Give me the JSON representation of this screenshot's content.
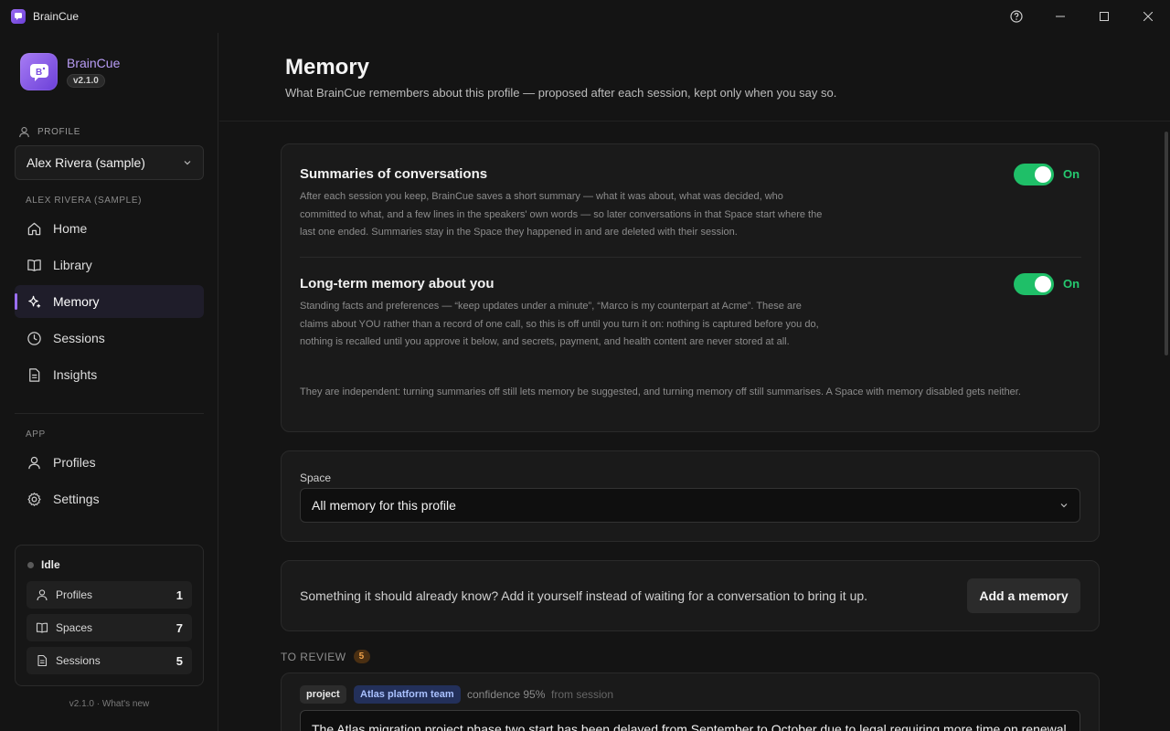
{
  "window": {
    "title": "BrainCue"
  },
  "brand": {
    "name": "BrainCue",
    "version": "v2.1.0"
  },
  "sidebar": {
    "profile_label": "PROFILE",
    "profile_value": "Alex Rivera (sample)",
    "profile_section": "ALEX RIVERA (SAMPLE)",
    "items": [
      {
        "label": "Home",
        "icon": "home-icon"
      },
      {
        "label": "Library",
        "icon": "book-icon"
      },
      {
        "label": "Memory",
        "icon": "sparkle-icon",
        "active": true
      },
      {
        "label": "Sessions",
        "icon": "clock-icon"
      },
      {
        "label": "Insights",
        "icon": "document-icon"
      }
    ],
    "app_section": "APP",
    "app_items": [
      {
        "label": "Profiles",
        "icon": "user-icon"
      },
      {
        "label": "Settings",
        "icon": "gear-icon"
      }
    ],
    "status": {
      "state": "Idle",
      "rows": [
        {
          "label": "Profiles",
          "value": "1"
        },
        {
          "label": "Spaces",
          "value": "7"
        },
        {
          "label": "Sessions",
          "value": "5"
        }
      ]
    },
    "footer": "v2.1.0 · What's new"
  },
  "main": {
    "title": "Memory",
    "subtitle": "What BrainCue remembers about this profile — proposed after each session, kept only when you say so.",
    "settings": {
      "summaries": {
        "title": "Summaries of conversations",
        "description": "After each session you keep, BrainCue saves a short summary — what it was about, what was decided, who committed to what, and a few lines in the speakers' own words — so later conversations in that Space start where the last one ended. Summaries stay in the Space they happened in and are deleted with their session.",
        "state": "On"
      },
      "longterm": {
        "title": "Long-term memory about you",
        "description": "Standing facts and preferences — “keep updates under a minute”, “Marco is my counterpart at Acme”. These are claims about YOU rather than a record of one call, so this is off until you turn it on: nothing is captured before you do, nothing is recalled until you approve it below, and secrets, payment, and health content are never stored at all.",
        "state": "On"
      },
      "note": "They are independent: turning summaries off still lets memory be suggested, and turning memory off still summarises. A Space with memory disabled gets neither."
    },
    "space": {
      "label": "Space",
      "value": "All memory for this profile"
    },
    "add": {
      "text": "Something it should already know? Add it yourself instead of waiting for a conversation to bring it up.",
      "button": "Add a memory"
    },
    "review": {
      "label": "TO REVIEW",
      "count": "5",
      "item": {
        "tag1": "project",
        "tag2": "Atlas platform team",
        "confidence": "confidence 95%",
        "source": "from session",
        "text": "The Atlas migration project phase two start has been delayed from September to October due to legal requiring more time on renewal"
      }
    }
  }
}
